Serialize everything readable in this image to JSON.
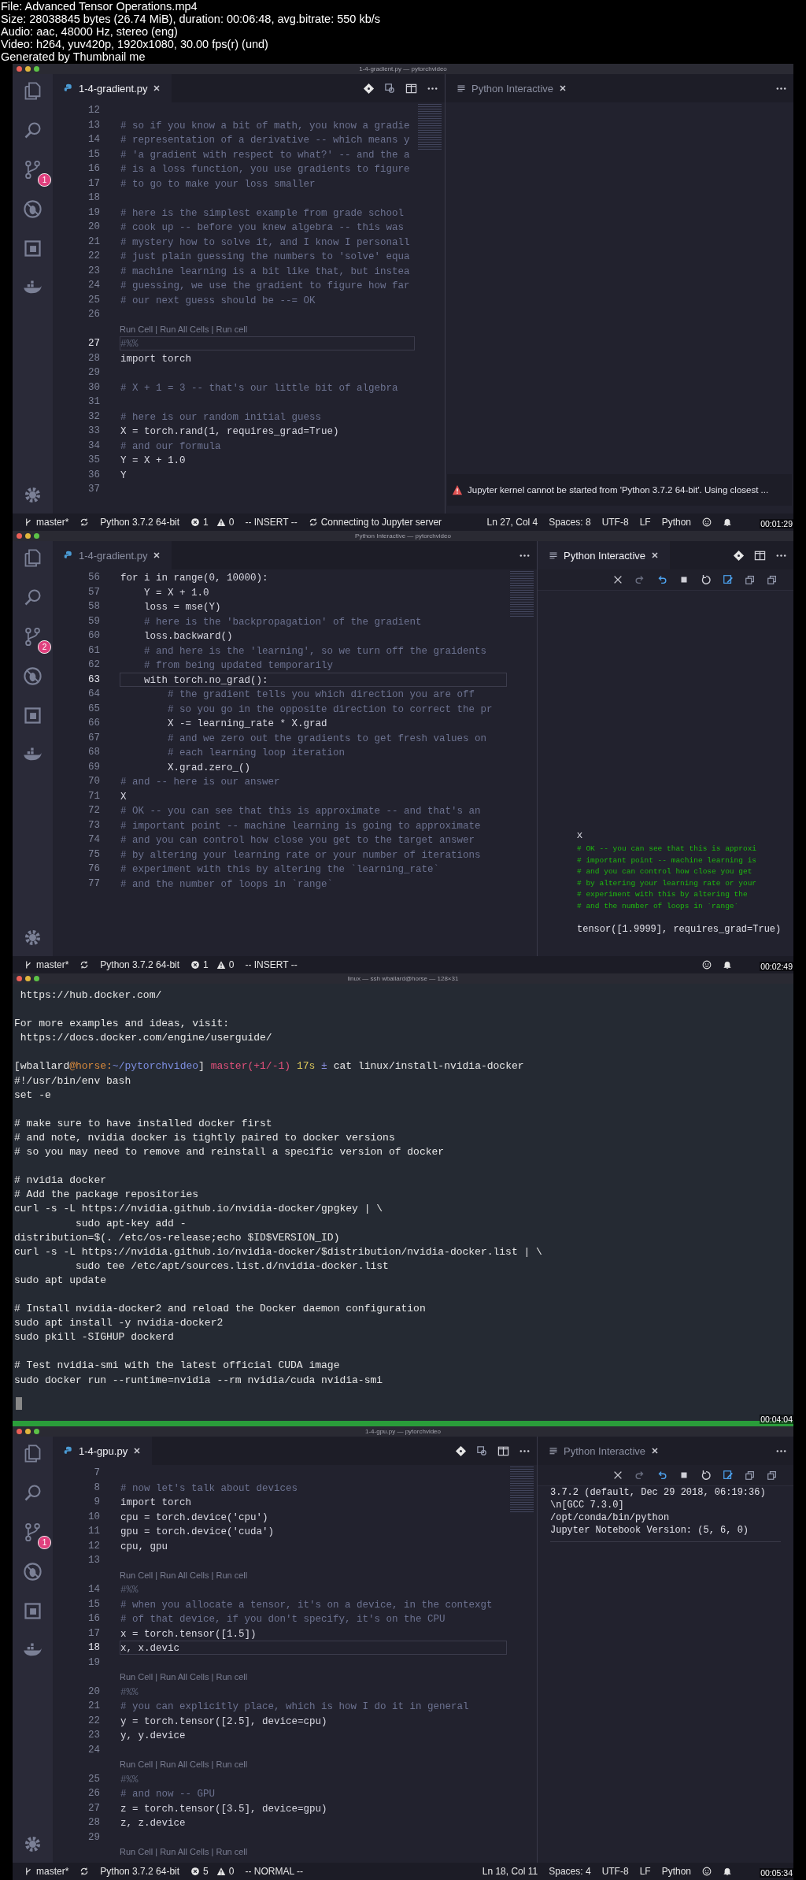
{
  "header": [
    "File: Advanced Tensor Operations.mp4",
    "Size: 28038845 bytes (26.74 MiB), duration: 00:06:48, avg.bitrate: 550 kb/s",
    "Audio: aac, 48000 Hz, stereo (eng)",
    "Video: h264, yuv420p, 1920x1080, 30.00 fps(r) (und)",
    "Generated by Thumbnail me"
  ],
  "frames": [
    {
      "kind": "editor",
      "window_title": "1-4-gradient.py — pytorchvideo",
      "editor_tab": {
        "label": "1-4-gradient.py",
        "focused": true
      },
      "source_control_badge": "1",
      "lines": [
        {
          "kind": "blank",
          "number": "12",
          "current": false
        },
        {
          "kind": "comment",
          "number": "13",
          "text": "# so if you know a bit of math, you know a gradie",
          "current": false
        },
        {
          "kind": "comment",
          "number": "14",
          "text": "# representation of a derivative -- which means y",
          "current": false
        },
        {
          "kind": "comment",
          "number": "15",
          "text": "# 'a gradient with respect to what?' -- and the a",
          "current": false
        },
        {
          "kind": "comment",
          "number": "16",
          "text": "# is a loss function, you use gradients to figure",
          "current": false
        },
        {
          "kind": "comment",
          "number": "17",
          "text": "# to go to make your loss smaller",
          "current": false
        },
        {
          "kind": "blank",
          "number": "18",
          "current": false
        },
        {
          "kind": "comment",
          "number": "19",
          "text": "# here is the simplest example from grade school",
          "current": false
        },
        {
          "kind": "comment",
          "number": "20",
          "text": "# cook up -- before you knew algebra -- this was",
          "current": false
        },
        {
          "kind": "comment",
          "number": "21",
          "text": "# mystery how to solve it, and I know I personall",
          "current": false
        },
        {
          "kind": "comment",
          "number": "22",
          "text": "# just plain guessing the numbers to 'solve' equa",
          "current": false
        },
        {
          "kind": "comment",
          "number": "23",
          "text": "# machine learning is a bit like that, but instea",
          "current": false
        },
        {
          "kind": "comment",
          "number": "24",
          "text": "# guessing, we use the gradient to figure how far",
          "current": false
        },
        {
          "kind": "comment",
          "number": "25",
          "text": "# our next guess should be --= OK",
          "current": false
        },
        {
          "kind": "blank",
          "number": "26",
          "current": false
        },
        {
          "kind": "lens",
          "text": "Run Cell | Run All Cells | Run cell",
          "current": false
        },
        {
          "kind": "cell",
          "number": "27",
          "text": "#%%",
          "current": true
        },
        {
          "kind": "code",
          "number": "28",
          "text": "import torch",
          "current": false
        },
        {
          "kind": "blank",
          "number": "29",
          "current": false
        },
        {
          "kind": "comment",
          "number": "30",
          "text": "# X + 1 = 3 -- that's our little bit of algebra",
          "current": false
        },
        {
          "kind": "blank",
          "number": "31",
          "current": false
        },
        {
          "kind": "comment",
          "number": "32",
          "text": "# here is our random initial guess",
          "current": false
        },
        {
          "kind": "code",
          "number": "33",
          "text": "X = torch.rand(1, requires_grad=True)",
          "current": false
        },
        {
          "kind": "comment",
          "number": "34",
          "text": "# and our formula",
          "current": false
        },
        {
          "kind": "code",
          "number": "35",
          "text": "Y = X + 1.0",
          "current": false
        },
        {
          "kind": "code",
          "number": "36",
          "text": "Y",
          "current": false
        },
        {
          "kind": "blank",
          "number": "37",
          "current": false
        }
      ],
      "panel": {
        "title": "Python Interactive",
        "focused": false,
        "toolbar": false,
        "notification": "Jupyter kernel cannot be started from 'Python 3.7.2 64-bit'. Using closest ..."
      },
      "status": {
        "branch": "master*",
        "interpreter": "Python 3.7.2 64-bit",
        "errors": "1",
        "warnings": "0",
        "mode": "-- INSERT --",
        "task": "Connecting to Jupyter server",
        "right": [
          "Ln 27, Col 4",
          "Spaces: 8",
          "UTF-8",
          "LF",
          "Python"
        ]
      },
      "timestamp": "00:01:29"
    },
    {
      "kind": "editor",
      "window_title": "Python Interactive — pytorchvideo",
      "editor_tab": {
        "label": "1-4-gradient.py",
        "focused": false
      },
      "source_control_badge": "2",
      "lines": [
        {
          "kind": "code",
          "number": "56",
          "text": "for i in range(0, 10000):",
          "current": false
        },
        {
          "kind": "code",
          "number": "57",
          "text": "    Y = X + 1.0",
          "current": false
        },
        {
          "kind": "code",
          "number": "58",
          "text": "    loss = mse(Y)",
          "current": false
        },
        {
          "kind": "comment",
          "number": "59",
          "text": "    # here is the 'backpropagation' of the gradient",
          "current": false
        },
        {
          "kind": "code",
          "number": "60",
          "text": "    loss.backward()",
          "current": false
        },
        {
          "kind": "comment",
          "number": "61",
          "text": "    # and here is the 'learning', so we turn off the graidents",
          "current": false
        },
        {
          "kind": "comment",
          "number": "62",
          "text": "    # from being updated temporarily",
          "current": false
        },
        {
          "kind": "code",
          "number": "63",
          "text": "    with torch.no_grad():",
          "current": true
        },
        {
          "kind": "comment",
          "number": "64",
          "text": "        # the gradient tells you which direction you are off",
          "current": false
        },
        {
          "kind": "comment",
          "number": "65",
          "text": "        # so you go in the opposite direction to correct the pr",
          "current": false
        },
        {
          "kind": "code",
          "number": "66",
          "text": "        X -= learning_rate * X.grad",
          "current": false
        },
        {
          "kind": "comment",
          "number": "67",
          "text": "        # and we zero out the gradients to get fresh values on",
          "current": false
        },
        {
          "kind": "comment",
          "number": "68",
          "text": "        # each learning loop iteration",
          "current": false
        },
        {
          "kind": "code",
          "number": "69",
          "text": "        X.grad.zero_()",
          "current": false
        },
        {
          "kind": "comment",
          "number": "70",
          "text": "# and -- here is our answer",
          "current": false
        },
        {
          "kind": "code",
          "number": "71",
          "text": "X",
          "current": false
        },
        {
          "kind": "comment",
          "number": "72",
          "text": "# OK -- you can see that this is approximate -- and that's an",
          "current": false
        },
        {
          "kind": "comment",
          "number": "73",
          "text": "# important point -- machine learning is going to approximate",
          "current": false
        },
        {
          "kind": "comment",
          "number": "74",
          "text": "# and you can control how close you get to the target answer",
          "current": false
        },
        {
          "kind": "comment",
          "number": "75",
          "text": "# by altering your learning rate or your number of iterations",
          "current": false
        },
        {
          "kind": "comment",
          "number": "76",
          "text": "# experiment with this by altering the `learning_rate`",
          "current": false
        },
        {
          "kind": "comment",
          "number": "77",
          "text": "# and the number of loops in `range`",
          "current": false
        }
      ],
      "panel": {
        "title": "Python Interactive",
        "focused": true,
        "toolbar": true,
        "output": [
          {
            "kind": "echo",
            "text": "X"
          },
          {
            "kind": "comment",
            "text": "# OK -- you can see that this is approxi"
          },
          {
            "kind": "comment",
            "text": "# important point -- machine learning is"
          },
          {
            "kind": "comment",
            "text": "# and you can control how close you get"
          },
          {
            "kind": "comment",
            "text": "# by altering your learning rate or your"
          },
          {
            "kind": "comment",
            "text": "# experiment with this by altering the"
          },
          {
            "kind": "comment",
            "text": "# and the number of loops in `range`"
          },
          {
            "kind": "result",
            "text": "tensor([1.9999], requires_grad=True)"
          }
        ]
      },
      "status": {
        "branch": "master*",
        "interpreter": "Python 3.7.2 64-bit",
        "errors": "1",
        "warnings": "0",
        "mode": "-- INSERT --"
      },
      "timestamp": "00:02:49"
    },
    {
      "kind": "terminal",
      "window_title": "linux — ssh wballard@horse — 128×31",
      "lines": [
        {
          "kind": "text",
          "text": " https://hub.docker.com/"
        },
        {
          "kind": "blank"
        },
        {
          "kind": "text",
          "text": "For more examples and ideas, visit:"
        },
        {
          "kind": "text",
          "text": " https://docs.docker.com/engine/userguide/"
        },
        {
          "kind": "blank"
        },
        {
          "kind": "prompt",
          "segments": [
            {
              "text": "[wballard",
              "color": "#e6e6e6"
            },
            {
              "text": "@horse:",
              "color": "#d98a3c"
            },
            {
              "text": "~/pytorchvideo",
              "color": "#7d8ee0"
            },
            {
              "text": "] ",
              "color": "#e6e6e6"
            },
            {
              "text": "master(+1/-1) ",
              "color": "#e0507a"
            },
            {
              "text": "17s ",
              "color": "#d6c25a"
            },
            {
              "text": "± ",
              "color": "#8a8fe0"
            },
            {
              "text": "cat linux/install-nvidia-docker",
              "color": "#e6e6e6"
            }
          ]
        },
        {
          "kind": "text",
          "text": "#!/usr/bin/env bash"
        },
        {
          "kind": "text",
          "text": "set -e"
        },
        {
          "kind": "blank"
        },
        {
          "kind": "text",
          "text": "# make sure to have installed docker first"
        },
        {
          "kind": "text",
          "text": "# and note, nvidia docker is tightly paired to docker versions"
        },
        {
          "kind": "text",
          "text": "# so you may need to remove and reinstall a specific version of docker"
        },
        {
          "kind": "blank"
        },
        {
          "kind": "text",
          "text": "# nvidia docker"
        },
        {
          "kind": "text",
          "text": "# Add the package repositories"
        },
        {
          "kind": "text",
          "text": "curl -s -L https://nvidia.github.io/nvidia-docker/gpgkey | \\"
        },
        {
          "kind": "text",
          "text": "          sudo apt-key add -"
        },
        {
          "kind": "text",
          "text": "distribution=$(. /etc/os-release;echo $ID$VERSION_ID)"
        },
        {
          "kind": "text",
          "text": "curl -s -L https://nvidia.github.io/nvidia-docker/$distribution/nvidia-docker.list | \\"
        },
        {
          "kind": "text",
          "text": "          sudo tee /etc/apt/sources.list.d/nvidia-docker.list"
        },
        {
          "kind": "text",
          "text": "sudo apt update"
        },
        {
          "kind": "blank"
        },
        {
          "kind": "text",
          "text": "# Install nvidia-docker2 and reload the Docker daemon configuration"
        },
        {
          "kind": "text",
          "text": "sudo apt install -y nvidia-docker2"
        },
        {
          "kind": "text",
          "text": "sudo pkill -SIGHUP dockerd"
        },
        {
          "kind": "blank"
        },
        {
          "kind": "text",
          "text": "# Test nvidia-smi with the latest official CUDA image"
        },
        {
          "kind": "text",
          "text": "sudo docker run --runtime=nvidia --rm nvidia/cuda nvidia-smi"
        }
      ],
      "timestamp": "00:04:04"
    },
    {
      "kind": "editor",
      "window_title": "1-4-gpu.py — pytorchvideo",
      "editor_tab": {
        "label": "1-4-gpu.py",
        "focused": true
      },
      "source_control_badge": "1",
      "lines": [
        {
          "kind": "blank",
          "number": "7",
          "current": false
        },
        {
          "kind": "comment",
          "number": "8",
          "text": "# now let's talk about devices",
          "current": false
        },
        {
          "kind": "code",
          "number": "9",
          "text": "import torch",
          "current": false
        },
        {
          "kind": "code",
          "number": "10",
          "text": "cpu = torch.device('cpu')",
          "current": false
        },
        {
          "kind": "code",
          "number": "11",
          "text": "gpu = torch.device('cuda')",
          "current": false
        },
        {
          "kind": "code",
          "number": "12",
          "text": "cpu, gpu",
          "current": false
        },
        {
          "kind": "blank",
          "number": "13",
          "current": false
        },
        {
          "kind": "lens",
          "text": "Run Cell | Run All Cells | Run cell",
          "current": false
        },
        {
          "kind": "cell",
          "number": "14",
          "text": "#%%",
          "current": false
        },
        {
          "kind": "comment",
          "number": "15",
          "text": "# when you allocate a tensor, it's on a device, in the contexgt",
          "current": false
        },
        {
          "kind": "comment",
          "number": "16",
          "text": "# of that device, if you don't specify, it's on the CPU",
          "current": false
        },
        {
          "kind": "code",
          "number": "17",
          "text": "x = torch.tensor([1.5])",
          "current": false
        },
        {
          "kind": "code",
          "number": "18",
          "text": "x, x.devic",
          "current": true
        },
        {
          "kind": "blank",
          "number": "19",
          "current": false
        },
        {
          "kind": "lens",
          "text": "Run Cell | Run All Cells | Run cell",
          "current": false
        },
        {
          "kind": "cell",
          "number": "20",
          "text": "#%%",
          "current": false
        },
        {
          "kind": "comment",
          "number": "21",
          "text": "# you can explicitly place, which is how I do it in general",
          "current": false
        },
        {
          "kind": "code",
          "number": "22",
          "text": "y = torch.tensor([2.5], device=cpu)",
          "current": false
        },
        {
          "kind": "code",
          "number": "23",
          "text": "y, y.device",
          "current": false
        },
        {
          "kind": "blank",
          "number": "24",
          "current": false
        },
        {
          "kind": "lens",
          "text": "Run Cell | Run All Cells | Run cell",
          "current": false
        },
        {
          "kind": "cell",
          "number": "25",
          "text": "#%%",
          "current": false
        },
        {
          "kind": "comment",
          "number": "26",
          "text": "# and now -- GPU",
          "current": false
        },
        {
          "kind": "code",
          "number": "27",
          "text": "z = torch.tensor([3.5], device=gpu)",
          "current": false
        },
        {
          "kind": "code",
          "number": "28",
          "text": "z, z.device",
          "current": false
        },
        {
          "kind": "blank",
          "number": "29",
          "current": false
        },
        {
          "kind": "lens",
          "text": "Run Cell | Run All Cells | Run cell",
          "current": false
        }
      ],
      "panel": {
        "title": "Python Interactive",
        "focused": false,
        "toolbar": true,
        "output": [
          {
            "kind": "result",
            "text": "3.7.2 (default, Dec 29 2018, 06:19:36)"
          },
          {
            "kind": "result",
            "text": "\\n[GCC 7.3.0]"
          },
          {
            "kind": "result",
            "text": "/opt/conda/bin/python"
          },
          {
            "kind": "result",
            "text": "Jupyter Notebook Version: (5, 6, 0)"
          }
        ]
      },
      "status": {
        "branch": "master*",
        "interpreter": "Python 3.7.2 64-bit",
        "errors": "5",
        "warnings": "0",
        "mode": "-- NORMAL --",
        "right": [
          "Ln 18, Col 11",
          "Spaces: 4",
          "UTF-8",
          "LF",
          "Python"
        ]
      },
      "timestamp": "00:05:34"
    }
  ]
}
